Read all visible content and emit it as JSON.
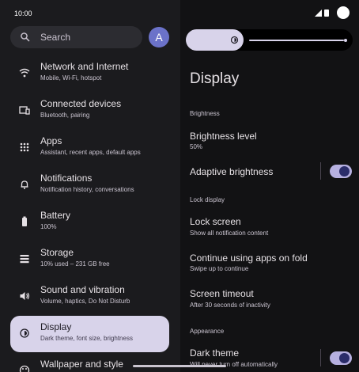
{
  "status_bar": {
    "time": "10:00"
  },
  "search": {
    "placeholder": "Search"
  },
  "avatar": {
    "letter": "A"
  },
  "nav": [
    {
      "key": "network",
      "icon": "wifi-icon",
      "title": "Network and Internet",
      "subtitle": "Mobile, Wi-Fi, hotspot"
    },
    {
      "key": "connected",
      "icon": "devices-icon",
      "title": "Connected devices",
      "subtitle": "Bluetooth, pairing"
    },
    {
      "key": "apps",
      "icon": "apps-grid-icon",
      "title": "Apps",
      "subtitle": "Assistant, recent apps, default apps"
    },
    {
      "key": "notifications",
      "icon": "bell-icon",
      "title": "Notifications",
      "subtitle": "Notification history, conversations"
    },
    {
      "key": "battery",
      "icon": "battery-icon",
      "title": "Battery",
      "subtitle": "100%"
    },
    {
      "key": "storage",
      "icon": "storage-icon",
      "title": "Storage",
      "subtitle": "10% used – 231 GB free"
    },
    {
      "key": "sound",
      "icon": "speaker-icon",
      "title": "Sound and vibration",
      "subtitle": "Volume, haptics, Do Not Disturb"
    },
    {
      "key": "display",
      "icon": "brightness-icon",
      "title": "Display",
      "subtitle": "Dark theme, font size, brightness"
    },
    {
      "key": "wallpaper",
      "icon": "palette-icon",
      "title": "Wallpaper and style",
      "subtitle": ""
    }
  ],
  "brightness_slider": {
    "level": 0.5
  },
  "display": {
    "title": "Display",
    "section_brightness": "Brightness",
    "brightness_level_title": "Brightness level",
    "brightness_level_value": "50%",
    "adaptive_title": "Adaptive brightness",
    "adaptive_on": true,
    "section_lock": "Lock display",
    "lock_screen_title": "Lock screen",
    "lock_screen_sub": "Show all notification content",
    "continue_title": "Continue using apps on fold",
    "continue_sub": "Swipe up to continue",
    "timeout_title": "Screen timeout",
    "timeout_sub": "After 30 seconds of inactivity",
    "section_appearance": "Appearance",
    "dark_title": "Dark theme",
    "dark_sub": "Will never turn off automatically",
    "dark_on": true
  },
  "colors": {
    "accent": "#d8d3ea",
    "toggle_track": "#b6b0e0",
    "avatar": "#6b72c9"
  }
}
